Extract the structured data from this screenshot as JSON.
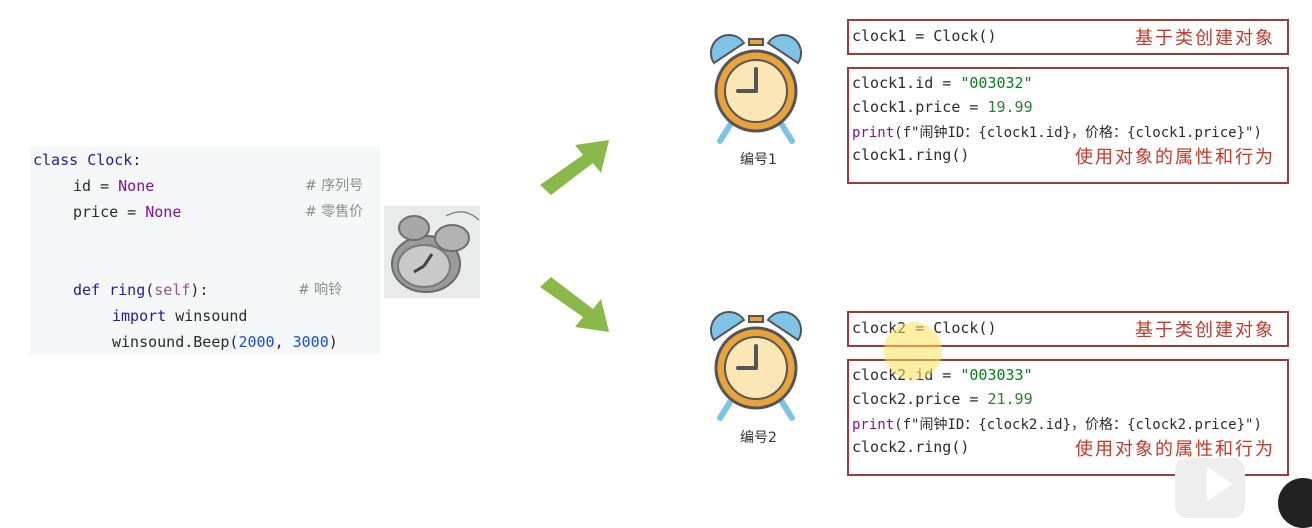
{
  "class_code": {
    "line1_kw": "class",
    "line1_name": "Clock",
    "line1_colon": ":",
    "line2_name": "id",
    "line2_eq": " = ",
    "line2_val": "None",
    "line2_comment": "# 序列号",
    "line3_name": "price",
    "line3_eq": " = ",
    "line3_val": "None",
    "line3_comment": "# 零售价",
    "line4_kw": "def",
    "line4_fn": "ring",
    "line4_open": "(",
    "line4_self": "self",
    "line4_close": "):",
    "line4_comment": "# 响铃",
    "line5_kw": "import",
    "line5_mod": " winsound",
    "line6_call": "winsound.Beep(",
    "line6_a": "2000",
    "line6_sep": ", ",
    "line6_b": "3000",
    "line6_end": ")"
  },
  "clock1": {
    "caption": "编号1",
    "create": "clock1 = Clock()",
    "create_note": "基于类创建对象",
    "id_lhs": "clock1.id = ",
    "id_val": "\"003032\"",
    "price_lhs": "clock1.price = ",
    "price_val": "19.99",
    "print_fn": "print",
    "print_rest": "(f\"闹钟ID：{clock1.id}，价格：{clock1.price}\")",
    "ring": "clock1.ring()",
    "use_note": "使用对象的属性和行为"
  },
  "clock2": {
    "caption": "编号2",
    "create": "clock2 = Clock()",
    "create_note": "基于类创建对象",
    "id_lhs": "clock2.id = ",
    "id_val": "\"003033\"",
    "price_lhs": "clock2.price = ",
    "price_val": "21.99",
    "print_fn": "print",
    "print_rest": "(f\"闹钟ID：{clock2.id}，价格：{clock2.price}\")",
    "ring": "clock2.ring()",
    "use_note": "使用对象的属性和行为"
  },
  "colors": {
    "box_border": "#9b3b3b",
    "note_red": "#c0392b",
    "arrow_green": "#8bb84a",
    "clock_orange": "#e8a33d",
    "clock_bell_blue": "#7fc4e6"
  },
  "icons": [
    "alarm-clock-icon",
    "alarm-clock-photo",
    "play-icon"
  ]
}
